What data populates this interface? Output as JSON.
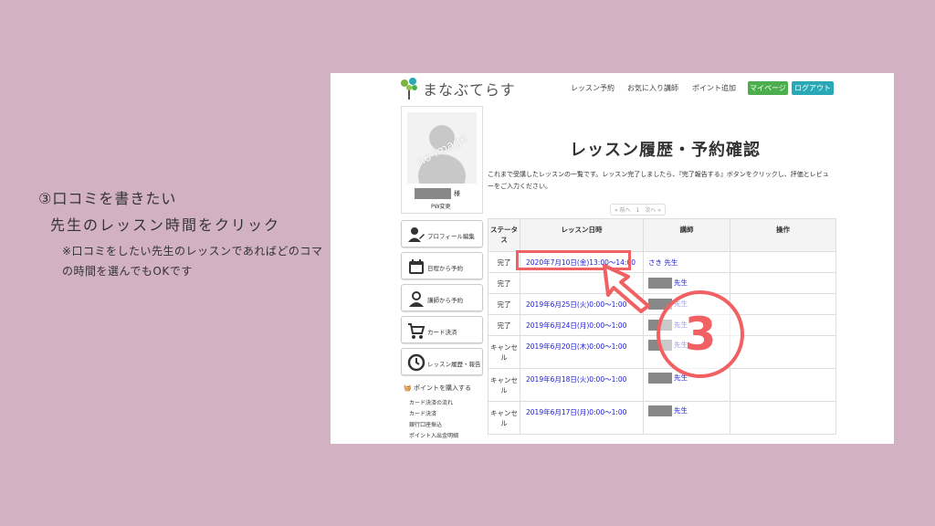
{
  "annotation": {
    "step": "③口コミを書きたい",
    "instruction": "先生のレッスン時間をクリック",
    "note": "※口コミをしたい先生のレッスンであればどのコマの時間を選んでもOKです"
  },
  "header": {
    "logo": "まなぶてらす",
    "nav": [
      "レッスン予約",
      "お気に入り講師",
      "ポイント追加"
    ],
    "mypage": "マイページ",
    "logout": "ログアウト"
  },
  "sidebar": {
    "noimage": "no image",
    "name_suffix": "様",
    "pw_change": "PW変更",
    "buttons": [
      {
        "label": "プロフィール編集",
        "icon": "profile-edit-icon"
      },
      {
        "label": "日程から予約",
        "icon": "calendar-icon"
      },
      {
        "label": "講師から予約",
        "icon": "teacher-icon"
      },
      {
        "label": "カード決済",
        "icon": "cart-icon"
      },
      {
        "label": "レッスン履歴・報告",
        "icon": "clock-icon"
      }
    ],
    "section_title": "ポイントを購入する",
    "links": [
      "カード決済の流れ",
      "カード決済",
      "銀行口座振込",
      "ポイント入出金明細"
    ]
  },
  "main": {
    "title": "レッスン履歴・予約確認",
    "description": "これまで受講したレッスンの一覧です。レッスン完了しましたら、『完了報告する』ボタンをクリックし、評価とレビューをご入力ください。",
    "pager": "« 前へ　1　次へ »",
    "headers": [
      "ステータス",
      "レッスン日時",
      "講師",
      "操作"
    ],
    "rows": [
      {
        "status": "完了",
        "datetime": "2020年7月10日(金)13:00～14:00",
        "teacher": "さき 先生",
        "redacted": false
      },
      {
        "status": "完了",
        "datetime": "",
        "teacher": "先生",
        "redacted": true
      },
      {
        "status": "完了",
        "datetime": "2019年6月25日(火)0:00～1:00",
        "teacher": "先生",
        "redacted": true
      },
      {
        "status": "完了",
        "datetime": "2019年6月24日(月)0:00～1:00",
        "teacher": "先生",
        "redacted": true
      },
      {
        "status": "キャンセル",
        "datetime": "2019年6月20日(木)0:00～1:00",
        "teacher": "先生",
        "redacted": true
      },
      {
        "status": "キャンセル",
        "datetime": "2019年6月18日(火)0:00～1:00",
        "teacher": "先生",
        "redacted": true
      },
      {
        "status": "キャンセル",
        "datetime": "2019年6月17日(月)0:00～1:00",
        "teacher": "先生",
        "redacted": true
      }
    ]
  },
  "callout": {
    "number": "3"
  },
  "colors": {
    "accent": "#f16062",
    "background": "#d2b1c2",
    "link": "#1b1bd4"
  }
}
